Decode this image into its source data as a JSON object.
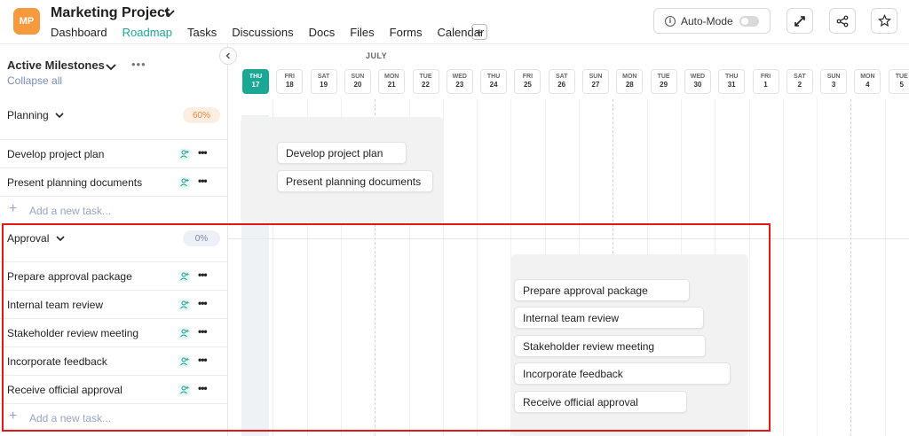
{
  "header": {
    "logo_initials": "MP",
    "project_title": "Marketing Project",
    "tabs": [
      "Dashboard",
      "Roadmap",
      "Tasks",
      "Discussions",
      "Docs",
      "Files",
      "Forms",
      "Calendar"
    ],
    "active_tab": "Roadmap",
    "auto_mode_label": "Auto-Mode",
    "auto_mode_on": false
  },
  "sidebar": {
    "heading": "Active Milestones",
    "collapse_label": "Collapse all",
    "groups": [
      {
        "name": "Planning",
        "progress": "60%",
        "tasks": [
          "Develop project plan",
          "Present planning documents"
        ],
        "add_label": "Add a new task..."
      },
      {
        "name": "Approval",
        "progress": "0%",
        "tasks": [
          "Prepare approval package",
          "Internal team review",
          "Stakeholder review meeting",
          "Incorporate feedback",
          "Receive official approval"
        ],
        "add_label": "Add a new task..."
      }
    ]
  },
  "timeline": {
    "month": "JULY",
    "days": [
      {
        "dow": "THU",
        "date": "17",
        "today": true
      },
      {
        "dow": "FRI",
        "date": "18"
      },
      {
        "dow": "SAT",
        "date": "19"
      },
      {
        "dow": "SUN",
        "date": "20"
      },
      {
        "dow": "MON",
        "date": "21"
      },
      {
        "dow": "TUE",
        "date": "22"
      },
      {
        "dow": "WED",
        "date": "23"
      },
      {
        "dow": "THU",
        "date": "24"
      },
      {
        "dow": "FRI",
        "date": "25"
      },
      {
        "dow": "SAT",
        "date": "26"
      },
      {
        "dow": "SUN",
        "date": "27"
      },
      {
        "dow": "MON",
        "date": "28"
      },
      {
        "dow": "TUE",
        "date": "29"
      },
      {
        "dow": "WED",
        "date": "30"
      },
      {
        "dow": "THU",
        "date": "31"
      },
      {
        "dow": "FRI",
        "date": "1"
      },
      {
        "dow": "SAT",
        "date": "2"
      },
      {
        "dow": "SUN",
        "date": "3"
      },
      {
        "dow": "MON",
        "date": "4"
      },
      {
        "dow": "TUE",
        "date": "5"
      }
    ]
  },
  "colors": {
    "accent": "#1aa794",
    "logo": "#f79a3e",
    "planning_progress": "#f0863a",
    "approval_progress": "#7b86b4",
    "highlight": "#e01818"
  },
  "icons": [
    "chevron-down-icon",
    "plus-icon",
    "info-icon",
    "expand-icon",
    "share-icon",
    "star-icon",
    "assign-user-icon",
    "more-icon",
    "chevron-left-icon"
  ]
}
